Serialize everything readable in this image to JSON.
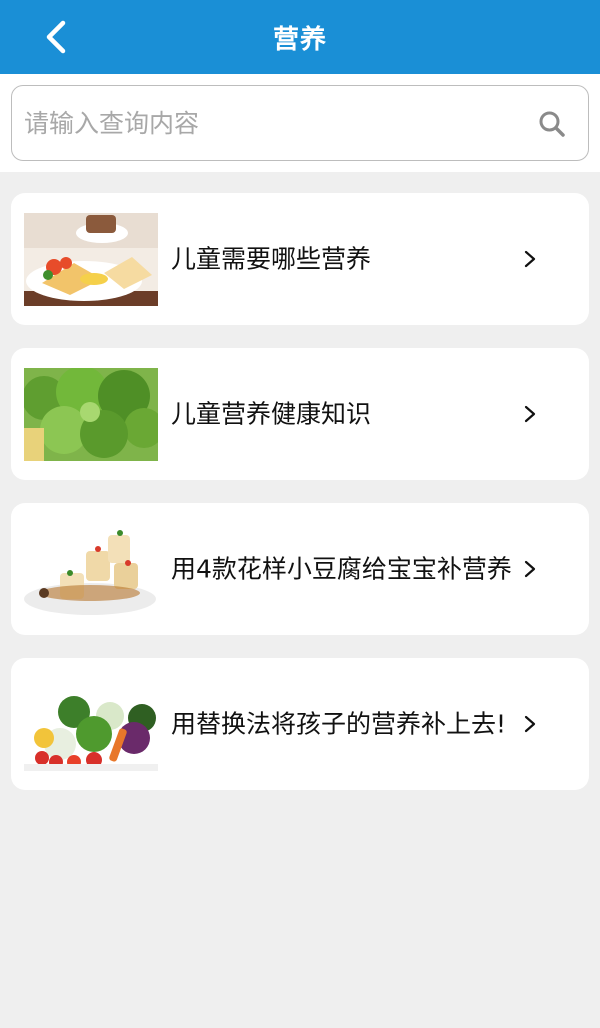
{
  "header": {
    "title": "营养",
    "back_icon": "chevron-left-icon"
  },
  "search": {
    "placeholder": "请输入查询内容",
    "value": "",
    "icon": "search-icon"
  },
  "articles": [
    {
      "title": "儿童需要哪些营养",
      "thumb": "breakfast-plate-image"
    },
    {
      "title": "儿童营养健康知识",
      "thumb": "leafy-greens-image"
    },
    {
      "title": "用4款花样小豆腐给宝宝补营养",
      "thumb": "tofu-dish-image"
    },
    {
      "title": "用替换法将孩子的营养补上去!",
      "thumb": "vegetables-image"
    }
  ],
  "colors": {
    "header_bg": "#1a8fd6",
    "page_bg": "#efefef",
    "card_bg": "#ffffff"
  }
}
